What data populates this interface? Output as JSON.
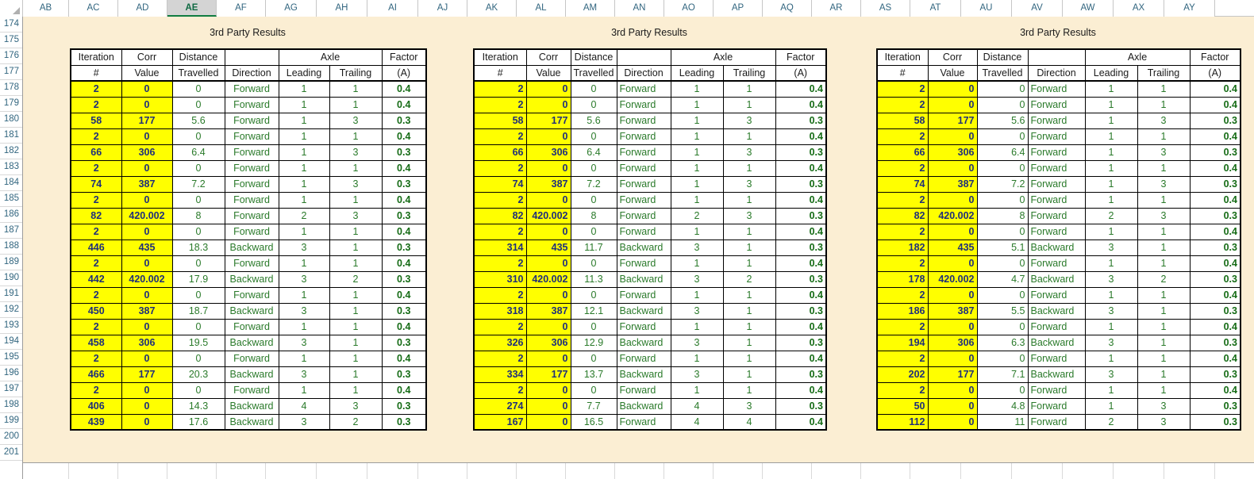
{
  "app": {
    "kind": "spreadsheet",
    "selected_column": "AE"
  },
  "column_headers": [
    "AB",
    "AC",
    "AD",
    "AE",
    "AF",
    "AG",
    "AH",
    "AI",
    "AJ",
    "AK",
    "AL",
    "AM",
    "AN",
    "AO",
    "AP",
    "AQ",
    "AR",
    "AS",
    "AT",
    "AU",
    "AV",
    "AW",
    "AX",
    "AY"
  ],
  "row_headers": [
    "174",
    "175",
    "176",
    "177",
    "178",
    "179",
    "180",
    "181",
    "182",
    "183",
    "184",
    "185",
    "186",
    "187",
    "188",
    "189",
    "190",
    "191",
    "192",
    "193",
    "194",
    "195",
    "196",
    "197",
    "198",
    "199",
    "200",
    "201"
  ],
  "colors": {
    "sheet_background": "#fbeed3",
    "highlight_cell": "#ffff00",
    "highlight_text": "#1f2f7a",
    "value_text": "#2a7a2a",
    "header_text": "#31657f",
    "selected_tab": "#107c41"
  },
  "tables": [
    {
      "title": "3rd Party  Results",
      "align": {
        "iter": "center",
        "corr": "center",
        "dist": "center",
        "dir": "center",
        "lead": "center",
        "trail": "center",
        "factor": "center"
      },
      "headers": {
        "top": [
          "Iteration",
          "Corr",
          "Distance",
          "",
          "Axle",
          "Factor"
        ],
        "iteration": "Iteration",
        "corr": "Corr",
        "distance": "Distance",
        "axle": "Axle",
        "factor": "Factor",
        "iteration2": "#",
        "corr2": "Value",
        "distance2": "Travelled",
        "direction2": "Direction",
        "leading2": "Leading",
        "trailing2": "Trailing",
        "factor2": "(A)"
      },
      "rows": [
        {
          "iter": "2",
          "corr": "0",
          "dist": "0",
          "dir": "Forward",
          "lead": "1",
          "trail": "1",
          "factor": "0.4"
        },
        {
          "iter": "2",
          "corr": "0",
          "dist": "0",
          "dir": "Forward",
          "lead": "1",
          "trail": "1",
          "factor": "0.4"
        },
        {
          "iter": "58",
          "corr": "177",
          "dist": "5.6",
          "dir": "Forward",
          "lead": "1",
          "trail": "3",
          "factor": "0.3"
        },
        {
          "iter": "2",
          "corr": "0",
          "dist": "0",
          "dir": "Forward",
          "lead": "1",
          "trail": "1",
          "factor": "0.4"
        },
        {
          "iter": "66",
          "corr": "306",
          "dist": "6.4",
          "dir": "Forward",
          "lead": "1",
          "trail": "3",
          "factor": "0.3"
        },
        {
          "iter": "2",
          "corr": "0",
          "dist": "0",
          "dir": "Forward",
          "lead": "1",
          "trail": "1",
          "factor": "0.4"
        },
        {
          "iter": "74",
          "corr": "387",
          "dist": "7.2",
          "dir": "Forward",
          "lead": "1",
          "trail": "3",
          "factor": "0.3"
        },
        {
          "iter": "2",
          "corr": "0",
          "dist": "0",
          "dir": "Forward",
          "lead": "1",
          "trail": "1",
          "factor": "0.4"
        },
        {
          "iter": "82",
          "corr": "420.002",
          "dist": "8",
          "dir": "Forward",
          "lead": "2",
          "trail": "3",
          "factor": "0.3"
        },
        {
          "iter": "2",
          "corr": "0",
          "dist": "0",
          "dir": "Forward",
          "lead": "1",
          "trail": "1",
          "factor": "0.4"
        },
        {
          "iter": "446",
          "corr": "435",
          "dist": "18.3",
          "dir": "Backward",
          "lead": "3",
          "trail": "1",
          "factor": "0.3"
        },
        {
          "iter": "2",
          "corr": "0",
          "dist": "0",
          "dir": "Forward",
          "lead": "1",
          "trail": "1",
          "factor": "0.4"
        },
        {
          "iter": "442",
          "corr": "420.002",
          "dist": "17.9",
          "dir": "Backward",
          "lead": "3",
          "trail": "2",
          "factor": "0.3"
        },
        {
          "iter": "2",
          "corr": "0",
          "dist": "0",
          "dir": "Forward",
          "lead": "1",
          "trail": "1",
          "factor": "0.4"
        },
        {
          "iter": "450",
          "corr": "387",
          "dist": "18.7",
          "dir": "Backward",
          "lead": "3",
          "trail": "1",
          "factor": "0.3"
        },
        {
          "iter": "2",
          "corr": "0",
          "dist": "0",
          "dir": "Forward",
          "lead": "1",
          "trail": "1",
          "factor": "0.4"
        },
        {
          "iter": "458",
          "corr": "306",
          "dist": "19.5",
          "dir": "Backward",
          "lead": "3",
          "trail": "1",
          "factor": "0.3"
        },
        {
          "iter": "2",
          "corr": "0",
          "dist": "0",
          "dir": "Forward",
          "lead": "1",
          "trail": "1",
          "factor": "0.4"
        },
        {
          "iter": "466",
          "corr": "177",
          "dist": "20.3",
          "dir": "Backward",
          "lead": "3",
          "trail": "1",
          "factor": "0.3"
        },
        {
          "iter": "2",
          "corr": "0",
          "dist": "0",
          "dir": "Forward",
          "lead": "1",
          "trail": "1",
          "factor": "0.4"
        },
        {
          "iter": "406",
          "corr": "0",
          "dist": "14.3",
          "dir": "Backward",
          "lead": "4",
          "trail": "3",
          "factor": "0.3"
        },
        {
          "iter": "439",
          "corr": "0",
          "dist": "17.6",
          "dir": "Backward",
          "lead": "3",
          "trail": "2",
          "factor": "0.3"
        }
      ]
    },
    {
      "title": "3rd Party  Results",
      "align": {
        "iter": "right",
        "corr": "right",
        "dist": "center",
        "dir": "left",
        "lead": "center",
        "trail": "center",
        "factor": "right"
      },
      "headers": {
        "iteration": "Iteration",
        "corr": "Corr",
        "distance": "Distance",
        "axle": "Axle",
        "factor": "Factor",
        "iteration2": "#",
        "corr2": "Value",
        "distance2": "Travelled",
        "direction2": "Direction",
        "leading2": "Leading",
        "trailing2": "Trailing",
        "factor2": "(A)"
      },
      "rows": [
        {
          "iter": "2",
          "corr": "0",
          "dist": "0",
          "dir": "Forward",
          "lead": "1",
          "trail": "1",
          "factor": "0.4"
        },
        {
          "iter": "2",
          "corr": "0",
          "dist": "0",
          "dir": "Forward",
          "lead": "1",
          "trail": "1",
          "factor": "0.4"
        },
        {
          "iter": "58",
          "corr": "177",
          "dist": "5.6",
          "dir": "Forward",
          "lead": "1",
          "trail": "3",
          "factor": "0.3"
        },
        {
          "iter": "2",
          "corr": "0",
          "dist": "0",
          "dir": "Forward",
          "lead": "1",
          "trail": "1",
          "factor": "0.4"
        },
        {
          "iter": "66",
          "corr": "306",
          "dist": "6.4",
          "dir": "Forward",
          "lead": "1",
          "trail": "3",
          "factor": "0.3"
        },
        {
          "iter": "2",
          "corr": "0",
          "dist": "0",
          "dir": "Forward",
          "lead": "1",
          "trail": "1",
          "factor": "0.4"
        },
        {
          "iter": "74",
          "corr": "387",
          "dist": "7.2",
          "dir": "Forward",
          "lead": "1",
          "trail": "3",
          "factor": "0.3"
        },
        {
          "iter": "2",
          "corr": "0",
          "dist": "0",
          "dir": "Forward",
          "lead": "1",
          "trail": "1",
          "factor": "0.4"
        },
        {
          "iter": "82",
          "corr": "420.002",
          "dist": "8",
          "dir": "Forward",
          "lead": "2",
          "trail": "3",
          "factor": "0.3"
        },
        {
          "iter": "2",
          "corr": "0",
          "dist": "0",
          "dir": "Forward",
          "lead": "1",
          "trail": "1",
          "factor": "0.4"
        },
        {
          "iter": "314",
          "corr": "435",
          "dist": "11.7",
          "dir": "Backward",
          "lead": "3",
          "trail": "1",
          "factor": "0.3"
        },
        {
          "iter": "2",
          "corr": "0",
          "dist": "0",
          "dir": "Forward",
          "lead": "1",
          "trail": "1",
          "factor": "0.4"
        },
        {
          "iter": "310",
          "corr": "420.002",
          "dist": "11.3",
          "dir": "Backward",
          "lead": "3",
          "trail": "2",
          "factor": "0.3"
        },
        {
          "iter": "2",
          "corr": "0",
          "dist": "0",
          "dir": "Forward",
          "lead": "1",
          "trail": "1",
          "factor": "0.4"
        },
        {
          "iter": "318",
          "corr": "387",
          "dist": "12.1",
          "dir": "Backward",
          "lead": "3",
          "trail": "1",
          "factor": "0.3"
        },
        {
          "iter": "2",
          "corr": "0",
          "dist": "0",
          "dir": "Forward",
          "lead": "1",
          "trail": "1",
          "factor": "0.4"
        },
        {
          "iter": "326",
          "corr": "306",
          "dist": "12.9",
          "dir": "Backward",
          "lead": "3",
          "trail": "1",
          "factor": "0.3"
        },
        {
          "iter": "2",
          "corr": "0",
          "dist": "0",
          "dir": "Forward",
          "lead": "1",
          "trail": "1",
          "factor": "0.4"
        },
        {
          "iter": "334",
          "corr": "177",
          "dist": "13.7",
          "dir": "Backward",
          "lead": "3",
          "trail": "1",
          "factor": "0.3"
        },
        {
          "iter": "2",
          "corr": "0",
          "dist": "0",
          "dir": "Forward",
          "lead": "1",
          "trail": "1",
          "factor": "0.4"
        },
        {
          "iter": "274",
          "corr": "0",
          "dist": "7.7",
          "dir": "Backward",
          "lead": "4",
          "trail": "3",
          "factor": "0.3"
        },
        {
          "iter": "167",
          "corr": "0",
          "dist": "16.5",
          "dir": "Forward",
          "lead": "4",
          "trail": "4",
          "factor": "0.4"
        }
      ]
    },
    {
      "title": "3rd Party  Results",
      "align": {
        "iter": "right",
        "corr": "right",
        "dist": "right",
        "dir": "left",
        "lead": "center",
        "trail": "center",
        "factor": "right"
      },
      "headers": {
        "iteration": "Iteration",
        "corr": "Corr",
        "distance": "Distance",
        "axle": "Axle",
        "factor": "Factor",
        "iteration2": "#",
        "corr2": "Value",
        "distance2": "Travelled",
        "direction2": "Direction",
        "leading2": "Leading",
        "trailing2": "Trailing",
        "factor2": "(A)"
      },
      "rows": [
        {
          "iter": "2",
          "corr": "0",
          "dist": "0",
          "dir": "Forward",
          "lead": "1",
          "trail": "1",
          "factor": "0.4"
        },
        {
          "iter": "2",
          "corr": "0",
          "dist": "0",
          "dir": "Forward",
          "lead": "1",
          "trail": "1",
          "factor": "0.4"
        },
        {
          "iter": "58",
          "corr": "177",
          "dist": "5.6",
          "dir": "Forward",
          "lead": "1",
          "trail": "3",
          "factor": "0.3"
        },
        {
          "iter": "2",
          "corr": "0",
          "dist": "0",
          "dir": "Forward",
          "lead": "1",
          "trail": "1",
          "factor": "0.4"
        },
        {
          "iter": "66",
          "corr": "306",
          "dist": "6.4",
          "dir": "Forward",
          "lead": "1",
          "trail": "3",
          "factor": "0.3"
        },
        {
          "iter": "2",
          "corr": "0",
          "dist": "0",
          "dir": "Forward",
          "lead": "1",
          "trail": "1",
          "factor": "0.4"
        },
        {
          "iter": "74",
          "corr": "387",
          "dist": "7.2",
          "dir": "Forward",
          "lead": "1",
          "trail": "3",
          "factor": "0.3"
        },
        {
          "iter": "2",
          "corr": "0",
          "dist": "0",
          "dir": "Forward",
          "lead": "1",
          "trail": "1",
          "factor": "0.4"
        },
        {
          "iter": "82",
          "corr": "420.002",
          "dist": "8",
          "dir": "Forward",
          "lead": "2",
          "trail": "3",
          "factor": "0.3"
        },
        {
          "iter": "2",
          "corr": "0",
          "dist": "0",
          "dir": "Forward",
          "lead": "1",
          "trail": "1",
          "factor": "0.4"
        },
        {
          "iter": "182",
          "corr": "435",
          "dist": "5.1",
          "dir": "Backward",
          "lead": "3",
          "trail": "1",
          "factor": "0.3"
        },
        {
          "iter": "2",
          "corr": "0",
          "dist": "0",
          "dir": "Forward",
          "lead": "1",
          "trail": "1",
          "factor": "0.4"
        },
        {
          "iter": "178",
          "corr": "420.002",
          "dist": "4.7",
          "dir": "Backward",
          "lead": "3",
          "trail": "2",
          "factor": "0.3"
        },
        {
          "iter": "2",
          "corr": "0",
          "dist": "0",
          "dir": "Forward",
          "lead": "1",
          "trail": "1",
          "factor": "0.4"
        },
        {
          "iter": "186",
          "corr": "387",
          "dist": "5.5",
          "dir": "Backward",
          "lead": "3",
          "trail": "1",
          "factor": "0.3"
        },
        {
          "iter": "2",
          "corr": "0",
          "dist": "0",
          "dir": "Forward",
          "lead": "1",
          "trail": "1",
          "factor": "0.4"
        },
        {
          "iter": "194",
          "corr": "306",
          "dist": "6.3",
          "dir": "Backward",
          "lead": "3",
          "trail": "1",
          "factor": "0.3"
        },
        {
          "iter": "2",
          "corr": "0",
          "dist": "0",
          "dir": "Forward",
          "lead": "1",
          "trail": "1",
          "factor": "0.4"
        },
        {
          "iter": "202",
          "corr": "177",
          "dist": "7.1",
          "dir": "Backward",
          "lead": "3",
          "trail": "1",
          "factor": "0.3"
        },
        {
          "iter": "2",
          "corr": "0",
          "dist": "0",
          "dir": "Forward",
          "lead": "1",
          "trail": "1",
          "factor": "0.4"
        },
        {
          "iter": "50",
          "corr": "0",
          "dist": "4.8",
          "dir": "Forward",
          "lead": "1",
          "trail": "3",
          "factor": "0.3"
        },
        {
          "iter": "112",
          "corr": "0",
          "dist": "11",
          "dir": "Forward",
          "lead": "2",
          "trail": "3",
          "factor": "0.3"
        }
      ]
    }
  ]
}
